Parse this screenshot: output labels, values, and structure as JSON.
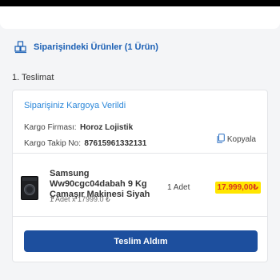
{
  "section": {
    "title": "Siparişindeki Ürünler (1 Ürün)"
  },
  "delivery": {
    "label": "1. Teslimat",
    "status": "Siparişiniz Kargoya Verildi",
    "firm_label": "Kargo Firması:",
    "firm_value": "Horoz Lojistik",
    "tracking_label": "Kargo Takip No:",
    "tracking_value": "87615961332131",
    "copy_label": "Kopyala"
  },
  "product": {
    "name": "Samsung Ww90cgc04dabah 9 Kg Çamaşır Makinesi Siyah",
    "quantity": "1 Adet",
    "price": "17.999,00₺",
    "unit_line": "1 Adet x 17999.0 ₺"
  },
  "action": {
    "label": "Teslim Aldım"
  },
  "colors": {
    "accent": "#1d4f9e",
    "status": "#2b87d9",
    "price_bg": "#ffe600",
    "price_text": "#d9381e"
  }
}
